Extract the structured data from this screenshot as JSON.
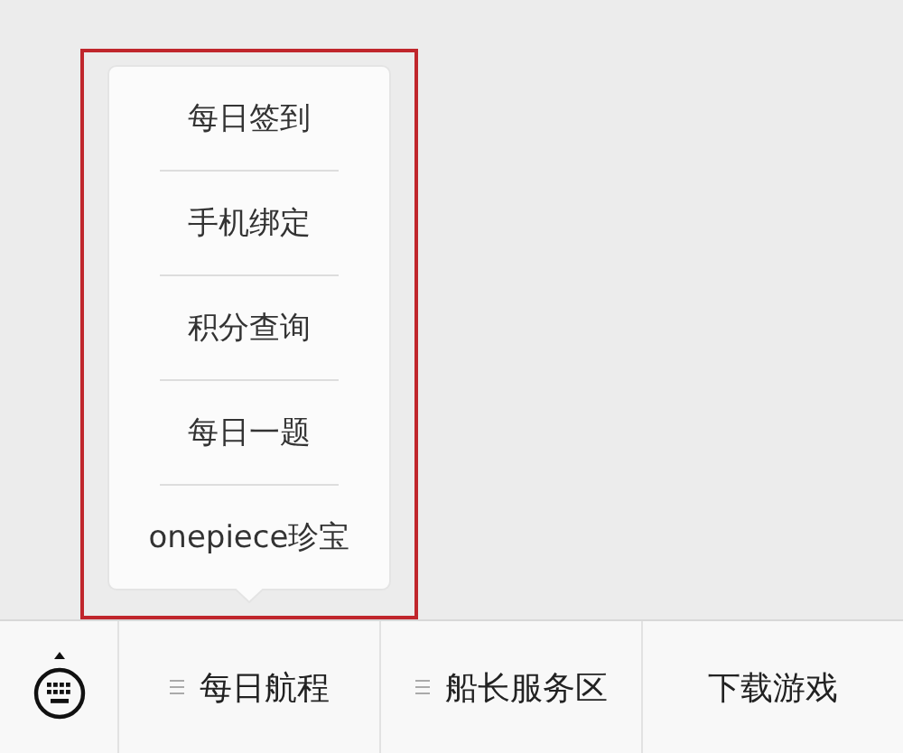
{
  "bottom_menu": {
    "tabs": [
      {
        "label": "每日航程",
        "kind": "submenu",
        "expanded": true,
        "items": [
          "每日签到",
          "手机绑定",
          "积分查询",
          "每日一题",
          "onepiece珍宝"
        ]
      },
      {
        "label": "船长服务区",
        "kind": "submenu",
        "expanded": false
      },
      {
        "label": "下载游戏",
        "kind": "link",
        "expanded": false
      }
    ]
  }
}
